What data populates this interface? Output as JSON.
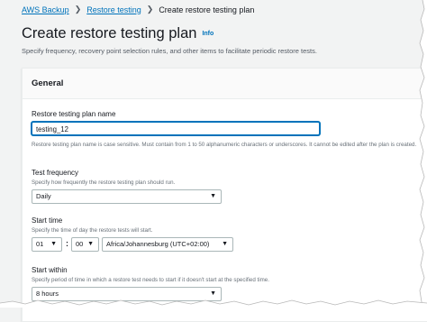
{
  "breadcrumb": {
    "items": [
      "AWS Backup",
      "Restore testing"
    ],
    "current": "Create restore testing plan"
  },
  "page": {
    "title": "Create restore testing plan",
    "info": "Info",
    "description": "Specify frequency, recovery point selection rules, and other items to facilitate periodic restore tests."
  },
  "general": {
    "title": "General",
    "plan_name": {
      "label": "Restore testing plan name",
      "value": "testing_12",
      "constraint": "Restore testing plan name is case sensitive. Must contain from 1 to 50 alphanumeric characters or underscores. It cannot be edited after the plan is created."
    },
    "frequency": {
      "label": "Test frequency",
      "hint": "Specify how frequently the restore testing plan should run.",
      "selected": "Daily"
    },
    "start_time": {
      "label": "Start time",
      "hint": "Specify the time of day the restore tests will start.",
      "hour": "01",
      "colon": ":",
      "minute": "00",
      "timezone": "Africa/Johannesburg (UTC+02:00)"
    },
    "start_within": {
      "label": "Start within",
      "hint": "Specify period of time in which a restore test needs to start if it doesn't start at the specified time.",
      "selected": "8 hours"
    }
  },
  "icons": {
    "caret": "▼",
    "separator": "❯"
  }
}
